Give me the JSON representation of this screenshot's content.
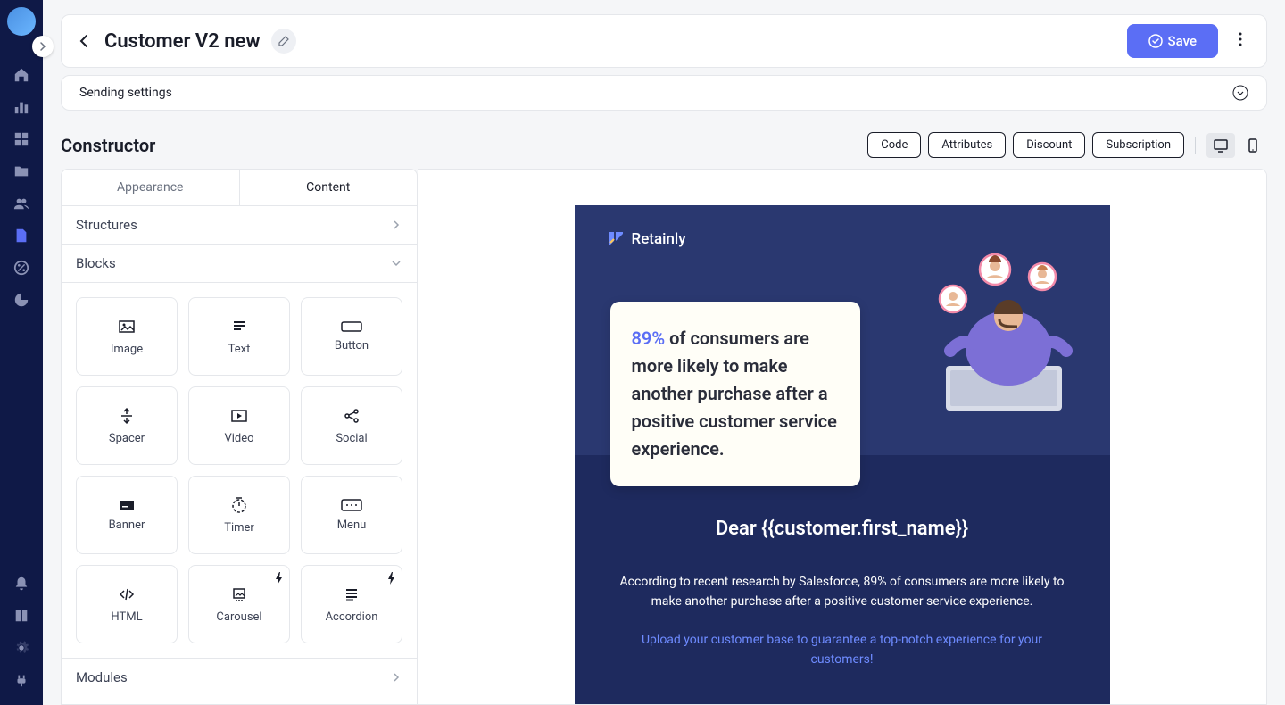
{
  "header": {
    "title": "Customer V2 new",
    "saveButton": "Save"
  },
  "settings": {
    "title": "Sending settings"
  },
  "constructor": {
    "title": "Constructor",
    "toolbarButtons": {
      "code": "Code",
      "attributes": "Attributes",
      "discount": "Discount",
      "subscription": "Subscription"
    }
  },
  "panel": {
    "tabs": {
      "appearance": "Appearance",
      "content": "Content"
    },
    "sections": {
      "structures": "Structures",
      "blocks": "Blocks",
      "modules": "Modules"
    },
    "blocks": [
      {
        "name": "image",
        "label": "Image"
      },
      {
        "name": "text",
        "label": "Text"
      },
      {
        "name": "button",
        "label": "Button"
      },
      {
        "name": "spacer",
        "label": "Spacer"
      },
      {
        "name": "video",
        "label": "Video"
      },
      {
        "name": "social",
        "label": "Social"
      },
      {
        "name": "banner",
        "label": "Banner"
      },
      {
        "name": "timer",
        "label": "Timer"
      },
      {
        "name": "menu",
        "label": "Menu"
      },
      {
        "name": "html",
        "label": "HTML"
      },
      {
        "name": "carousel",
        "label": "Carousel"
      },
      {
        "name": "accordion",
        "label": "Accordion"
      }
    ]
  },
  "email": {
    "logoText": "Retainly",
    "cardPercent": "89%",
    "cardText": " of consumers are more likely to make another purchase after a positive customer service experience.",
    "greeting": "Dear {{customer.first_name}}",
    "bodyText": "According to recent research by Salesforce, 89% of consumers are more likely to make another purchase after a positive customer service experience.",
    "linkText": "Upload your customer base to guarantee a top-notch experience for your customers!"
  }
}
